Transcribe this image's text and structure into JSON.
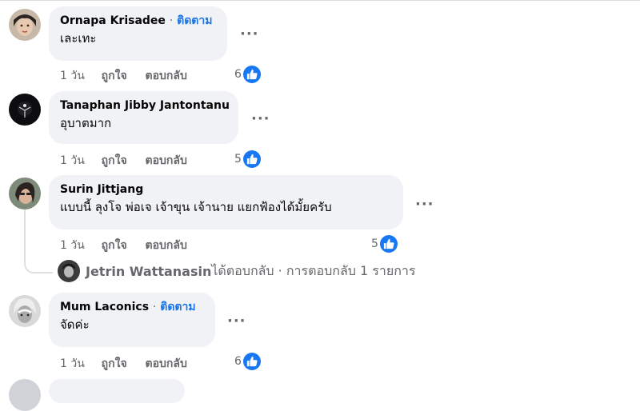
{
  "comments": [
    {
      "name": "Ornapa Krisadee",
      "follow": "ติดตาม",
      "text": "เละเทะ",
      "time": "1 วัน",
      "like_label": "ถูกใจ",
      "reply_label": "ตอบกลับ",
      "likes": "6"
    },
    {
      "name": "Tanaphan Jibby Jantontanu",
      "follow": "",
      "text": "อุบาตมาก",
      "time": "1 วัน",
      "like_label": "ถูกใจ",
      "reply_label": "ตอบกลับ",
      "likes": "5"
    },
    {
      "name": "Surin Jittjang",
      "follow": "",
      "text": "แบบนี้ ลุงโจ พ่อเจ เจ้าขุน เจ้านาย แยกฟ้องได้มั้ยครับ",
      "time": "1 วัน",
      "like_label": "ถูกใจ",
      "reply_label": "ตอบกลับ",
      "likes": "5"
    },
    {
      "name": "Mum Laconics",
      "follow": "ติดตาม",
      "text": "จัดค่ะ",
      "time": "1 วัน",
      "like_label": "ถูกใจ",
      "reply_label": "ตอบกลับ",
      "likes": "6"
    }
  ],
  "reply": {
    "name": "Jetrin Wattanasin",
    "text": " ได้ตอบกลับ · การตอบกลับ 1 รายการ"
  },
  "separator": "·",
  "more_glyph": "···",
  "colors": {
    "bubble": "#f0f2f5",
    "link_blue": "#1b74e4",
    "like_blue": "#1877f2",
    "meta_gray": "#65676b"
  },
  "icons": [
    "more-options-icon",
    "like-thumb-icon"
  ]
}
